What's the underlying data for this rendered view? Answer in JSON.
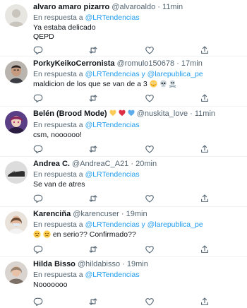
{
  "reply_prefix": "En respuesta a",
  "conjunction": "y",
  "tweets": [
    {
      "name": "alvaro amaro pizarro",
      "handle": "@alvaroaldo",
      "time": "11min",
      "mentions": [
        "@LRTendencias"
      ],
      "lines": [
        "Ya estaba delicado",
        "QEPD"
      ],
      "avatar": "default-egg-avatar"
    },
    {
      "name": "PorkyKeikoCerronista",
      "handle": "@romulo150678",
      "time": "17min",
      "mentions": [
        "@LRTendencias",
        "@larepublica_pe"
      ],
      "lines": [
        "maldicion de los que se van de a 3"
      ],
      "emojis": [
        "flushed-face",
        "skull",
        "skull-crossbones"
      ],
      "avatar": "man-photo-avatar"
    },
    {
      "name": "Belén (Brood Mode)",
      "handle": "@nuskita_love",
      "time": "11min",
      "mentions": [
        "@LRTendencias"
      ],
      "lines": [
        "csm, noooooo!"
      ],
      "name_badges": [
        "yellow-heart",
        "red-heart",
        "blue-heart"
      ],
      "avatar": "anime-character-avatar"
    },
    {
      "name": "Andrea C.",
      "handle": "@AndreaC_A21",
      "time": "20min",
      "mentions": [
        "@LRTendencias"
      ],
      "lines": [
        "Se van de atres"
      ],
      "avatar": "shoe-photo-avatar"
    },
    {
      "name": "Karenciña",
      "handle": "@karencuser",
      "time": "19min",
      "mentions": [
        "@LRTendencias",
        "@larepublica_pe"
      ],
      "lines": [
        "en serio?? Confirmado??"
      ],
      "lead_emojis": [
        "sad-face",
        "sad-face"
      ],
      "avatar": "woman-photo-avatar"
    },
    {
      "name": "Hilda Bisso",
      "handle": "@hildabisso",
      "time": "19min",
      "mentions": [
        "@LRTendencias"
      ],
      "lines": [
        "Nooooooo"
      ],
      "avatar": "woman-photo-avatar"
    }
  ],
  "colors": {
    "mention": "#1d9bf0",
    "secondary": "#536471",
    "divider": "#eff3f4"
  },
  "action_icons": [
    "reply-icon",
    "retweet-icon",
    "like-icon",
    "share-icon"
  ]
}
